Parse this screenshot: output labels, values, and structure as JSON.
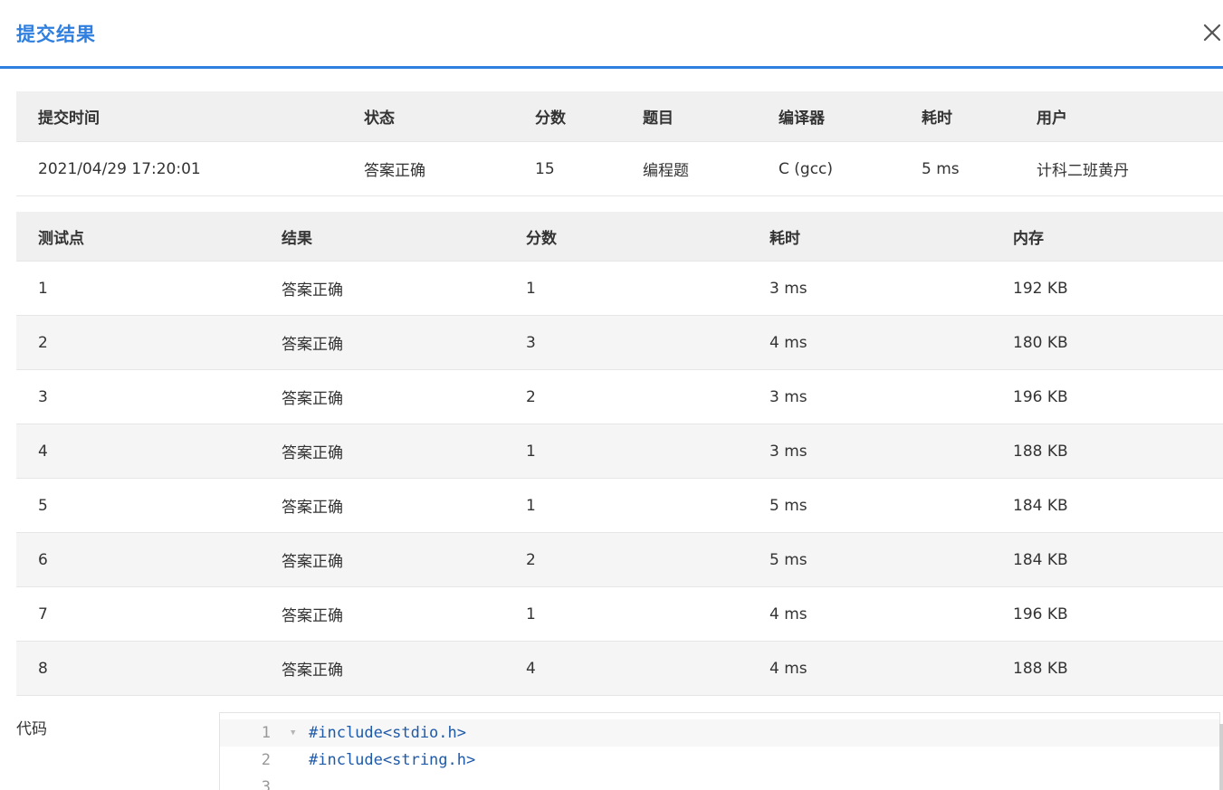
{
  "dialog": {
    "title": "提交结果"
  },
  "summary": {
    "headers": [
      "提交时间",
      "状态",
      "分数",
      "题目",
      "编译器",
      "耗时",
      "用户"
    ],
    "row": {
      "time": "2021/04/29 17:20:01",
      "status": "答案正确",
      "score": "15",
      "problem": "编程题",
      "compiler": "C (gcc)",
      "duration": "5 ms",
      "user": "计科二班黄丹"
    }
  },
  "cases": {
    "headers": [
      "测试点",
      "结果",
      "分数",
      "耗时",
      "内存"
    ],
    "rows": [
      {
        "id": "1",
        "result": "答案正确",
        "score": "1",
        "time": "3 ms",
        "memory": "192 KB"
      },
      {
        "id": "2",
        "result": "答案正确",
        "score": "3",
        "time": "4 ms",
        "memory": "180 KB"
      },
      {
        "id": "3",
        "result": "答案正确",
        "score": "2",
        "time": "3 ms",
        "memory": "196 KB"
      },
      {
        "id": "4",
        "result": "答案正确",
        "score": "1",
        "time": "3 ms",
        "memory": "188 KB"
      },
      {
        "id": "5",
        "result": "答案正确",
        "score": "1",
        "time": "5 ms",
        "memory": "184 KB"
      },
      {
        "id": "6",
        "result": "答案正确",
        "score": "2",
        "time": "5 ms",
        "memory": "184 KB"
      },
      {
        "id": "7",
        "result": "答案正确",
        "score": "1",
        "time": "4 ms",
        "memory": "196 KB"
      },
      {
        "id": "8",
        "result": "答案正确",
        "score": "4",
        "time": "4 ms",
        "memory": "188 KB"
      }
    ]
  },
  "code": {
    "label": "代码",
    "lines": [
      {
        "num": "1",
        "text": "#include<stdio.h>"
      },
      {
        "num": "2",
        "text": "#include<string.h>"
      },
      {
        "num": "3",
        "text": ""
      }
    ]
  },
  "colors": {
    "accent": "#2f7fe0",
    "success_text": "#e8372f",
    "header_bg": "#f0f0f0",
    "stripe_bg": "#f5f5f5"
  },
  "icons": {
    "close": "close-icon",
    "fold": "fold-arrow-icon"
  }
}
